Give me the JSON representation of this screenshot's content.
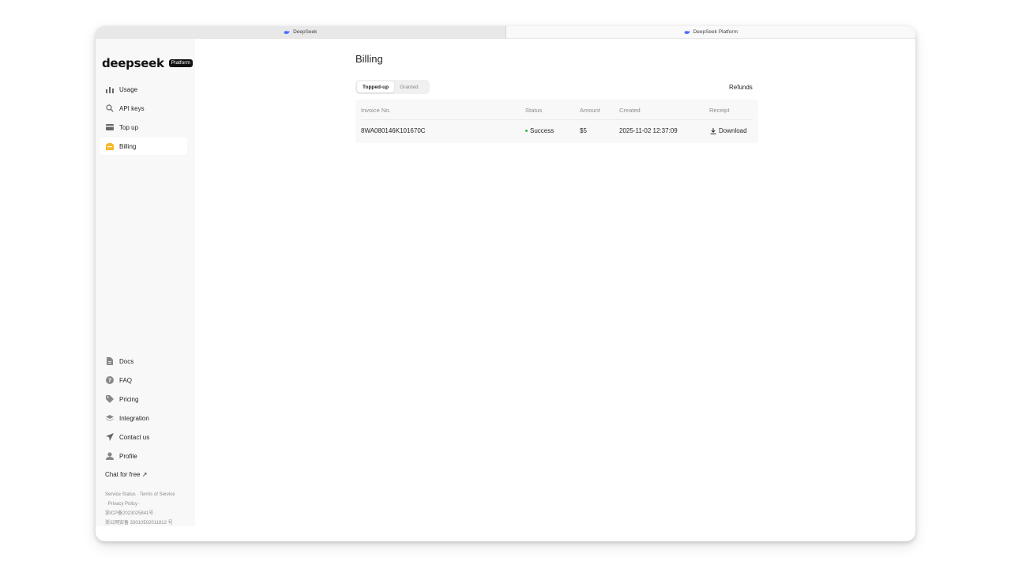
{
  "tabs": [
    {
      "label": "DeepSeek"
    },
    {
      "label": "DeepSeek Platform"
    }
  ],
  "brand": {
    "name": "deepseek",
    "badge": "Platform"
  },
  "sidebar": {
    "top_items": [
      {
        "label": "Usage",
        "icon": "bar-chart-icon"
      },
      {
        "label": "API keys",
        "icon": "search-icon"
      },
      {
        "label": "Top up",
        "icon": "card-icon"
      },
      {
        "label": "Billing",
        "icon": "billing-icon"
      }
    ],
    "bottom_items": [
      {
        "label": "Docs",
        "icon": "document-icon"
      },
      {
        "label": "FAQ",
        "icon": "question-icon"
      },
      {
        "label": "Pricing",
        "icon": "tag-icon"
      },
      {
        "label": "Integration",
        "icon": "layers-icon"
      },
      {
        "label": "Contact us",
        "icon": "send-icon"
      },
      {
        "label": "Profile",
        "icon": "user-icon"
      }
    ],
    "chat_free": "Chat for free ↗",
    "footer": {
      "service_status": "Service Status",
      "terms": "Terms of Service",
      "privacy": "Privacy Policy",
      "icp": "浙ICP备2023025841号",
      "police": "浙公网安备 33010502011812 号"
    }
  },
  "main": {
    "title": "Billing",
    "tabs": [
      "Topped-up",
      "Granted"
    ],
    "active_tab": "Topped-up",
    "refunds": "Refunds",
    "table": {
      "headers": [
        "Invoice No.",
        "Status",
        "Amount",
        "Created",
        "Receipt"
      ],
      "rows": [
        {
          "invoice": "8WA080146K101670C",
          "status": "Success",
          "amount": "$5",
          "created": "2025-11-02 12:37:09",
          "receipt": "Download"
        }
      ]
    }
  },
  "colors": {
    "accent_billing": "#f5b82e",
    "success": "#3bb54a",
    "sidebar_bg": "#f8f8f8"
  }
}
